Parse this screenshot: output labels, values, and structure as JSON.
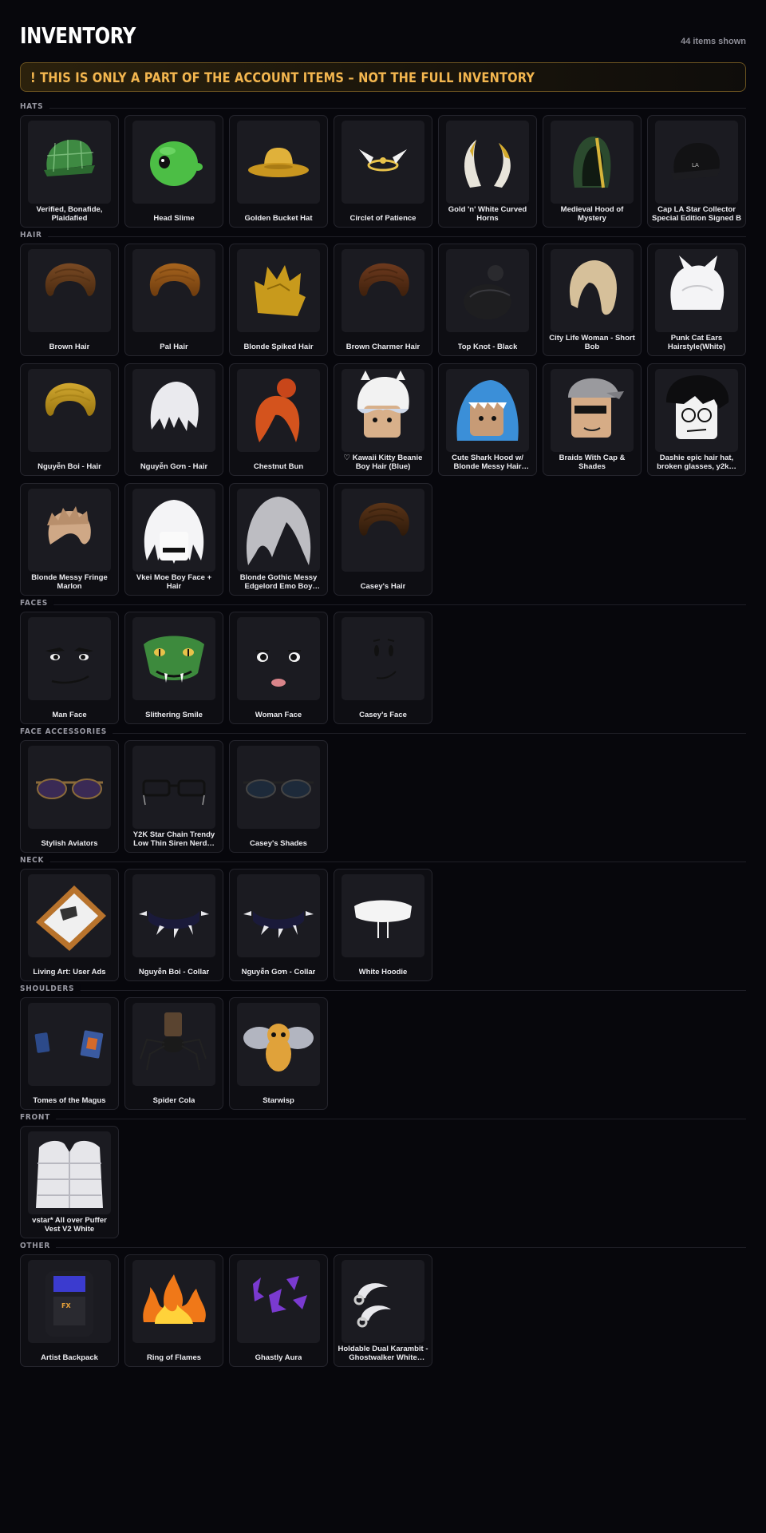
{
  "header": {
    "title": "INVENTORY",
    "count": "44 items shown",
    "notice": "! THIS IS ONLY A PART OF THE ACCOUNT ITEMS – NOT THE FULL INVENTORY"
  },
  "colors": {
    "background": "#07070c",
    "card": "#0e0e13",
    "accent": "#f3b64f",
    "notice_border": "#6b5320"
  },
  "sections": [
    {
      "title": "HATS",
      "items": [
        {
          "name": "Verified, Bonafide, Plaidafied",
          "icon": "plaid-cap-icon"
        },
        {
          "name": "Head Slime",
          "icon": "slime-head-icon"
        },
        {
          "name": "Golden Bucket Hat",
          "icon": "bucket-hat-icon"
        },
        {
          "name": "Circlet of Patience",
          "icon": "circlet-icon"
        },
        {
          "name": "Gold 'n' White Curved Horns",
          "icon": "horns-icon"
        },
        {
          "name": "Medieval Hood of Mystery",
          "icon": "hood-icon"
        },
        {
          "name": "Cap LA Star Collector Special Edition Signed B",
          "icon": "black-cap-icon"
        }
      ]
    },
    {
      "title": "HAIR",
      "items": [
        {
          "name": "Brown Hair",
          "icon": "hair-icon"
        },
        {
          "name": "Pal Hair",
          "icon": "hair-icon"
        },
        {
          "name": "Blonde Spiked Hair",
          "icon": "spiked-hair-icon"
        },
        {
          "name": "Brown Charmer Hair",
          "icon": "hair-icon"
        },
        {
          "name": "Top Knot - Black",
          "icon": "top-knot-icon"
        },
        {
          "name": "City Life Woman - Short Bob",
          "icon": "bob-hair-icon"
        },
        {
          "name": "Punk Cat Ears Hairstyle(White)",
          "icon": "cat-ears-hair-icon"
        },
        {
          "name": "Nguyễn Boi - Hair",
          "icon": "hair-icon"
        },
        {
          "name": "Nguyễn Gơn - Hair",
          "icon": "white-hair-icon"
        },
        {
          "name": "Chestnut Bun",
          "icon": "bun-hair-icon"
        },
        {
          "name": "♡ Kawaii Kitty Beanie Boy Hair (Blue)",
          "icon": "kitty-beanie-icon"
        },
        {
          "name": "Cute Shark Hood w/ Blonde Messy Hair (Em…",
          "icon": "shark-hood-icon"
        },
        {
          "name": "Braids With Cap & Shades",
          "icon": "cap-shades-icon"
        },
        {
          "name": "Dashie epic hair hat, broken glasses, y2k…",
          "icon": "glasses-hair-icon"
        },
        {
          "name": "Blonde Messy Fringe Marlon",
          "icon": "messy-hair-icon"
        },
        {
          "name": "Vkei Moe Boy Face + Hair",
          "icon": "vkei-hair-icon"
        },
        {
          "name": "Blonde Gothic Messy Edgelord Emo Boy Hair…",
          "icon": "emo-hair-icon"
        },
        {
          "name": "Casey's Hair",
          "icon": "hair-icon"
        }
      ]
    },
    {
      "title": "FACES",
      "items": [
        {
          "name": "Man Face",
          "icon": "man-face-icon"
        },
        {
          "name": "Slithering Smile",
          "icon": "snake-face-icon"
        },
        {
          "name": "Woman Face",
          "icon": "woman-face-icon"
        },
        {
          "name": "Casey's Face",
          "icon": "simple-face-icon"
        }
      ]
    },
    {
      "title": "FACE ACCESSORIES",
      "items": [
        {
          "name": "Stylish Aviators",
          "icon": "aviators-icon"
        },
        {
          "name": "Y2K Star Chain Trendy Low Thin Siren Nerd…",
          "icon": "glasses-icon"
        },
        {
          "name": "Casey's Shades",
          "icon": "shades-icon"
        }
      ]
    },
    {
      "title": "NECK",
      "items": [
        {
          "name": "Living Art: User Ads",
          "icon": "picture-frame-icon"
        },
        {
          "name": "Nguyễn Boi - Collar",
          "icon": "spiked-collar-icon"
        },
        {
          "name": "Nguyễn Gơn - Collar",
          "icon": "spiked-collar-icon"
        },
        {
          "name": "White Hoodie",
          "icon": "hoodie-icon"
        }
      ]
    },
    {
      "title": "SHOULDERS",
      "items": [
        {
          "name": "Tomes of the Magus",
          "icon": "tomes-icon"
        },
        {
          "name": "Spider Cola",
          "icon": "spider-icon"
        },
        {
          "name": "Starwisp",
          "icon": "fairy-icon"
        }
      ]
    },
    {
      "title": "FRONT",
      "items": [
        {
          "name": "vstar* All over Puffer Vest V2 White",
          "icon": "puffer-vest-icon"
        }
      ]
    },
    {
      "title": "OTHER",
      "items": [
        {
          "name": "Artist Backpack",
          "icon": "backpack-icon"
        },
        {
          "name": "Ring of Flames",
          "icon": "flames-icon"
        },
        {
          "name": "Ghastly Aura",
          "icon": "aura-icon"
        },
        {
          "name": "Holdable Dual Karambit - Ghostwalker White Silver",
          "icon": "karambit-icon"
        }
      ]
    }
  ]
}
